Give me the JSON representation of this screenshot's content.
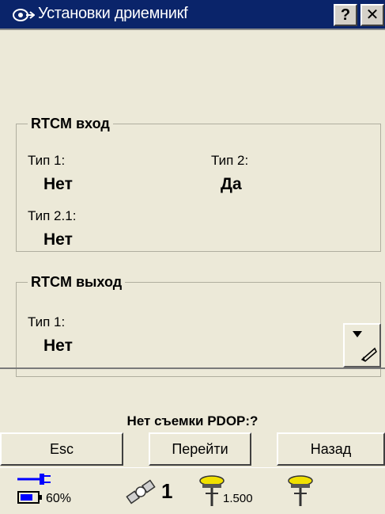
{
  "window": {
    "title": "Установки дриемникf",
    "help_label": "?",
    "close_label": "✕",
    "app_icon": "satellite-app-icon"
  },
  "rtcm_in": {
    "legend": "RTCM вход",
    "type1_label": "Тип 1:",
    "type1_value": "Нет",
    "type2_label": "Тип 2:",
    "type2_value": "Да",
    "type21_label": "Тип 2.1:",
    "type21_value": "Нет"
  },
  "rtcm_out": {
    "legend": "RTCM выход",
    "type1_label": "Тип 1:",
    "type1_value": "Нет"
  },
  "status": {
    "text": "Нет съемки  PDOP:?"
  },
  "buttons": {
    "esc": "Esc",
    "goto": "Перейти",
    "back": "Назад"
  },
  "taskbar": {
    "battery_percent": "60%",
    "satellites": "1",
    "rover_value": "1.500",
    "icons": [
      "power-plug-icon",
      "battery-icon",
      "satellite-icon",
      "rover-receiver-icon",
      "base-receiver-icon"
    ]
  },
  "colors": {
    "titlebar": "#0a246a",
    "background": "#ece9d8",
    "accent_blue": "#0000ff",
    "receiver_yellow": "#f0e000"
  }
}
